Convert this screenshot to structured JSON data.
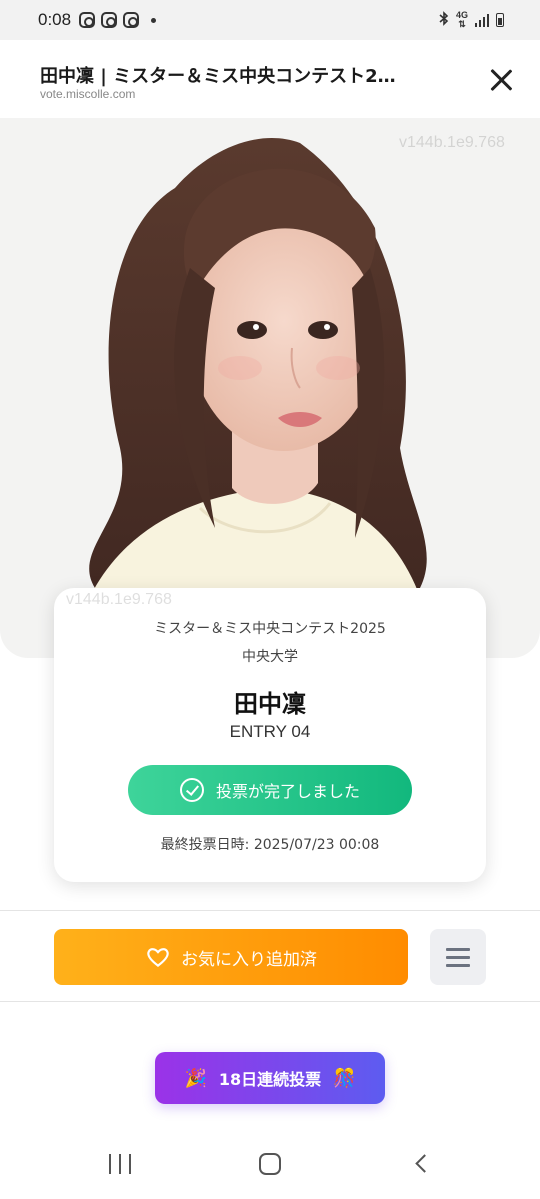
{
  "status_bar": {
    "time": "0:08",
    "left_icons": [
      "instagram-icon",
      "instagram-icon",
      "instagram-icon",
      "dot-icon"
    ],
    "network": "4G",
    "right_icons": [
      "bluetooth-icon",
      "network-icon",
      "signal-icon",
      "battery-icon"
    ]
  },
  "browser": {
    "title": "田中凜 | ミスター＆ミス中央コンテスト2…",
    "url": "vote.miscolle.com",
    "close_icon": "close-icon"
  },
  "hero": {
    "watermark": "v144b.1e9.768",
    "photo_description_icon": "portrait-photo"
  },
  "entry_card": {
    "watermark": "v144b.1e9.768",
    "contest": "ミスター＆ミス中央コンテスト2025",
    "university": "中央大学",
    "name": "田中凜",
    "entry_number": "ENTRY 04",
    "vote_button_label": "投票が完了しました",
    "last_vote": "最終投票日時: 2025/07/23 00:08"
  },
  "actions": {
    "favorite_label": "お気に入り追加済",
    "favorite_icon": "heart-icon",
    "menu_icon": "hamburger-menu-icon"
  },
  "streak": {
    "label": "18日連続投票",
    "left_emoji": "🎉",
    "right_emoji": "🎊"
  },
  "nav_bar": {
    "icons": [
      "recent-apps-icon",
      "home-icon",
      "back-icon"
    ]
  },
  "colors": {
    "vote_green": "#1fc187",
    "favorite_orange": "#ff9f0a",
    "streak_purple": "#7c47ec"
  }
}
